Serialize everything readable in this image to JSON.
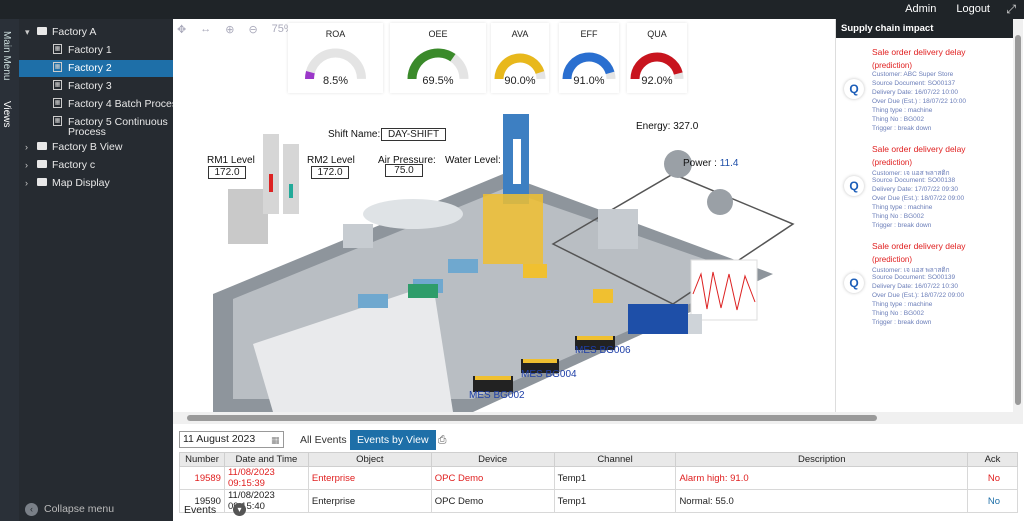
{
  "topbar": {
    "admin": "Admin",
    "logout": "Logout",
    "expand_icon": "expand-icon"
  },
  "vtabs": {
    "main_menu": "Main Menu",
    "views": "Views"
  },
  "sidebar": {
    "items": [
      {
        "label": "Factory A",
        "kind": "folder"
      },
      {
        "label": "Factory 1",
        "kind": "page"
      },
      {
        "label": "Factory 2",
        "kind": "page",
        "selected": true
      },
      {
        "label": "Factory 3",
        "kind": "page"
      },
      {
        "label": "Factory 4 Batch Process",
        "kind": "page"
      },
      {
        "label": "Factory 5 Continuous",
        "label2": "Process",
        "kind": "page"
      },
      {
        "label": "Factory B View",
        "kind": "folder"
      },
      {
        "label": "Factory c",
        "kind": "folder"
      },
      {
        "label": "Map Display",
        "kind": "folder"
      }
    ],
    "collapse": "Collapse menu"
  },
  "canvas": {
    "zoom": "75%",
    "gauges": [
      {
        "label": "ROA",
        "value": "8.5%",
        "fraction": 0.085,
        "color": "#9b37c9"
      },
      {
        "label": "OEE",
        "value": "69.5%",
        "fraction": 0.695,
        "color": "#3a8a2a"
      },
      {
        "label": "AVA",
        "value": "90.0%",
        "fraction": 0.9,
        "color": "#e8b81c"
      },
      {
        "label": "EFF",
        "value": "91.0%",
        "fraction": 0.91,
        "color": "#2a6fd0"
      },
      {
        "label": "QUA",
        "value": "92.0%",
        "fraction": 0.92,
        "color": "#c8141e"
      }
    ],
    "shift_label": "Shift Name:",
    "shift_value": "DAY-SHIFT",
    "rm1_label": "RM1 Level",
    "rm1_value": "172.0",
    "rm2_label": "RM2 Level",
    "rm2_value": "172.0",
    "air_label": "Air Pressure:",
    "air_value": "75.0",
    "water_label": "Water Level:",
    "energy_label": "Energy:",
    "energy_value": "327.0",
    "power_label": "Power :",
    "power_value": "11.4",
    "mes": [
      "MES BG002",
      "MES BG004",
      "MES BG006"
    ]
  },
  "supply": {
    "title": "Supply chain impact",
    "cards": [
      {
        "t1": "Sale order delivery delay",
        "t2": "(prediction)",
        "lines": [
          "Customer: ABC Super Store",
          "Source Document: SO00137",
          "Delivery Date: 16/07/22 10:00",
          "Over Due (Est.) : 18/07/22 10:00",
          "Thing type : machine",
          "Thing No : BG002",
          "Trigger : break down"
        ]
      },
      {
        "t1": "Sale order delivery delay",
        "t2": "(prediction)",
        "lines": [
          "Customer: เจ แอส พลาสติก",
          "Source Document: SO00138",
          "Delivery Date: 17/07/22 09:30",
          "Over Due (Est.): 18/07/22 09:00",
          "Thing type : machine",
          "Thing No : BG002",
          "Trigger : break down"
        ]
      },
      {
        "t1": "Sale order delivery delay",
        "t2": "(prediction)",
        "lines": [
          "Customer: เจ แอส พลาสติก",
          "Source Document: SO00139",
          "Delivery Date: 16/07/22 10:30",
          "Over Due (Est.): 18/07/22 09:00",
          "Thing type : machine",
          "Thing No : BG002",
          "Trigger : break down"
        ]
      }
    ]
  },
  "events": {
    "date": "11 August 2023",
    "tab_all": "All Events",
    "tab_view": "Events by View",
    "columns": [
      "Number",
      "Date and Time",
      "Object",
      "Device",
      "Channel",
      "Description",
      "Ack"
    ],
    "rows": [
      {
        "number": "19589",
        "datetime": "11/08/2023 09:15:39",
        "object": "Enterprise",
        "device": "OPC Demo",
        "channel": "Temp1",
        "description": "Alarm high: 91.0",
        "ack": "No",
        "alarm": true
      },
      {
        "number": "19590",
        "datetime": "11/08/2023 09:15:40",
        "object": "Enterprise",
        "device": "OPC Demo",
        "channel": "Temp1",
        "description": "Normal: 55.0",
        "ack": "No",
        "alarm": false
      }
    ],
    "footer_label": "Events"
  }
}
